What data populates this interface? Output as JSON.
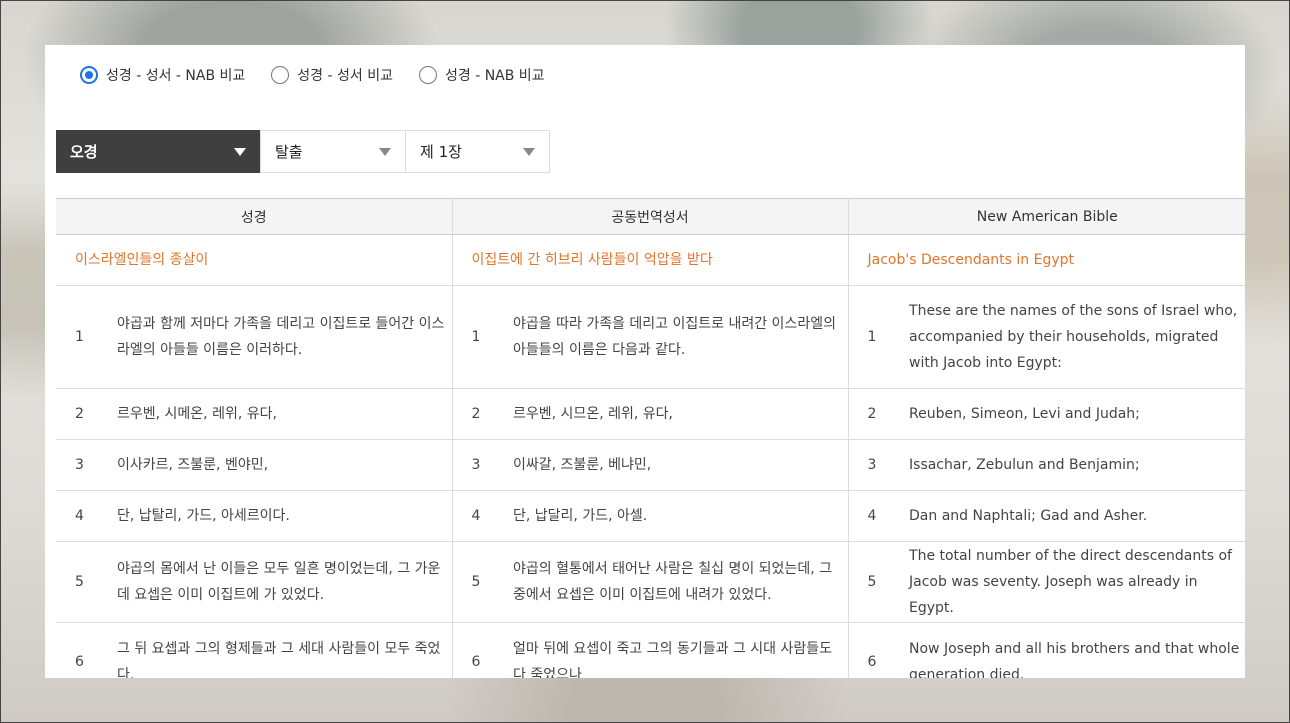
{
  "radio_options": [
    {
      "label": "성경 - 성서 - NAB 비교",
      "checked": true
    },
    {
      "label": "성경 - 성서 비교",
      "checked": false
    },
    {
      "label": "성경 - NAB 비교",
      "checked": false
    }
  ],
  "selects": {
    "testament": "오경",
    "book": "탈출",
    "chapter": "제 1장"
  },
  "table": {
    "headers": [
      "성경",
      "공동번역성서",
      "New American Bible"
    ],
    "section_titles": [
      "이스라엘인들의 종살이",
      "이집트에 간 히브리 사람들이 억압을 받다",
      "Jacob's Descendants in Egypt"
    ],
    "rows": [
      {
        "num": "1",
        "cols": [
          "야곱과 함께 저마다 가족을 데리고 이집트로 들어간 이스라엘의 아들들 이름은 이러하다.",
          "야곱을 따라 가족을 데리고 이집트로 내려간 이스라엘의 아들들의 이름은 다음과 같다.",
          "These are the names of the sons of Israel who, accompanied by their households, migrated with Jacob into Egypt:"
        ]
      },
      {
        "num": "2",
        "cols": [
          "르우벤, 시메온, 레위, 유다,",
          "르우벤, 시므온, 레위, 유다,",
          "Reuben, Simeon, Levi and Judah;"
        ]
      },
      {
        "num": "3",
        "cols": [
          "이사카르, 즈불룬, 벤야민,",
          "이싸갈, 즈불룬, 베냐민,",
          "Issachar, Zebulun and Benjamin;"
        ]
      },
      {
        "num": "4",
        "cols": [
          "단, 납탈리, 가드, 아세르이다.",
          "단, 납달리, 가드, 아셀.",
          "Dan and Naphtali; Gad and Asher."
        ]
      },
      {
        "num": "5",
        "cols": [
          "야곱의 몸에서 난 이들은 모두 일흔 명이었는데, 그 가운데 요셉은 이미 이집트에 가 있었다.",
          "야곱의 혈통에서 태어난 사람은 칠십 명이 되었는데, 그 중에서 요셉은 이미 이집트에 내려가 있었다.",
          "The total number of the direct descendants of Jacob was seventy. Joseph was already in Egypt."
        ]
      },
      {
        "num": "6",
        "cols": [
          "그 뒤 요셉과 그의 형제들과 그 세대 사람들이 모두 죽었다.",
          "얼마 뒤에 요셉이 죽고 그의 동기들과 그 시대 사람들도 다 죽었으나",
          "Now Joseph and all his brothers and that whole generation died."
        ]
      }
    ]
  },
  "colors": {
    "accent": "#e0752b",
    "radio_selected": "#1a73e8",
    "dark_select": "#3f3f3f"
  }
}
